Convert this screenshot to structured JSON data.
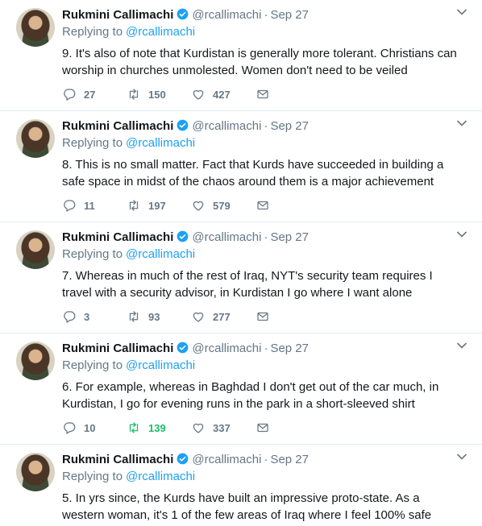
{
  "tweets": [
    {
      "name": "Rukmini Callimachi",
      "handle": "@rcallimachi",
      "separator": "·",
      "date": "Sep 27",
      "replying_prefix": "Replying to",
      "replying_to": "@rcallimachi",
      "text": "9. It's also of note that Kurdistan is generally more tolerant. Christians can worship in churches unmolested. Women don't need to be veiled",
      "replies": "27",
      "retweets": "150",
      "likes": "427",
      "retweeted": false
    },
    {
      "name": "Rukmini Callimachi",
      "handle": "@rcallimachi",
      "separator": "·",
      "date": "Sep 27",
      "replying_prefix": "Replying to",
      "replying_to": "@rcallimachi",
      "text": "8. This is no small matter. Fact that Kurds have succeeded in building a safe space in midst of the chaos around them is a major achievement",
      "replies": "11",
      "retweets": "197",
      "likes": "579",
      "retweeted": false
    },
    {
      "name": "Rukmini Callimachi",
      "handle": "@rcallimachi",
      "separator": "·",
      "date": "Sep 27",
      "replying_prefix": "Replying to",
      "replying_to": "@rcallimachi",
      "text": "7. Whereas in much of the rest of Iraq, NYT's security team requires I travel with a security advisor, in Kurdistan I go where I want alone",
      "replies": "3",
      "retweets": "93",
      "likes": "277",
      "retweeted": false
    },
    {
      "name": "Rukmini Callimachi",
      "handle": "@rcallimachi",
      "separator": "·",
      "date": "Sep 27",
      "replying_prefix": "Replying to",
      "replying_to": "@rcallimachi",
      "text": "6. For example, whereas in Baghdad I don't get out of the car much, in Kurdistan, I go for evening runs in the park in a short-sleeved shirt",
      "replies": "10",
      "retweets": "139",
      "likes": "337",
      "retweeted": true
    },
    {
      "name": "Rukmini Callimachi",
      "handle": "@rcallimachi",
      "separator": "·",
      "date": "Sep 27",
      "replying_prefix": "Replying to",
      "replying_to": "@rcallimachi",
      "text": "5. In yrs since, the Kurds have built an impressive proto-state. As a western woman, it's 1 of the few areas of Iraq where I feel 100% safe",
      "replies": "",
      "retweets": "",
      "likes": "",
      "retweeted": false
    }
  ],
  "icons": {
    "verified": "verified-badge-icon",
    "caret": "chevron-down-icon",
    "reply": "reply-icon",
    "retweet": "retweet-icon",
    "like": "heart-icon",
    "dm": "envelope-icon"
  },
  "colors": {
    "link": "#1da1f2",
    "muted": "#657786",
    "text": "#14171a",
    "retweet_active": "#17bf63",
    "border": "#e6ecf0"
  }
}
